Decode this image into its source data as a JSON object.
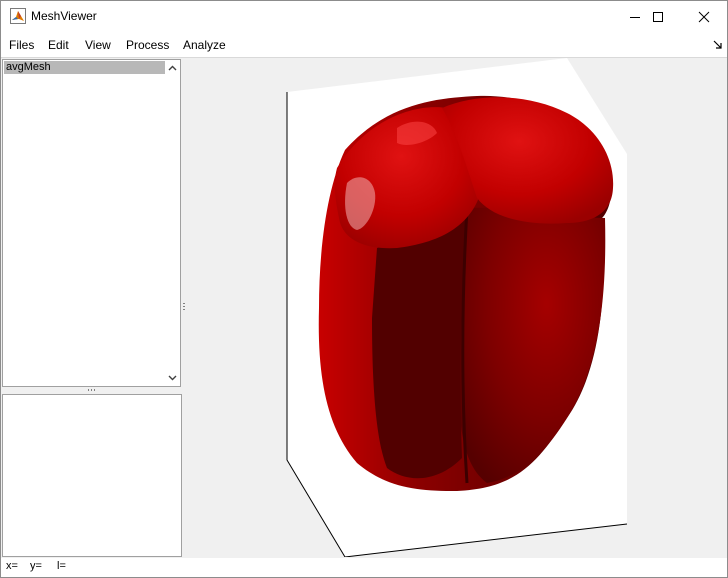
{
  "window": {
    "title": "MeshViewer",
    "controls": [
      "minimize",
      "maximize",
      "close"
    ]
  },
  "menu": {
    "items": [
      "Files",
      "Edit",
      "View",
      "Process",
      "Analyze"
    ]
  },
  "mesh_list": {
    "items": [
      {
        "label": "avgMesh",
        "selected": true
      }
    ]
  },
  "viewport": {
    "mesh_color": "#d40000",
    "shadow_color": "#5a0000",
    "background": "#ffffff"
  },
  "status": {
    "x_label": "x=",
    "y_label": "y=",
    "l_label": "l="
  },
  "icons": {
    "app": "matlab-icon",
    "dock": "undock-arrow-icon"
  }
}
